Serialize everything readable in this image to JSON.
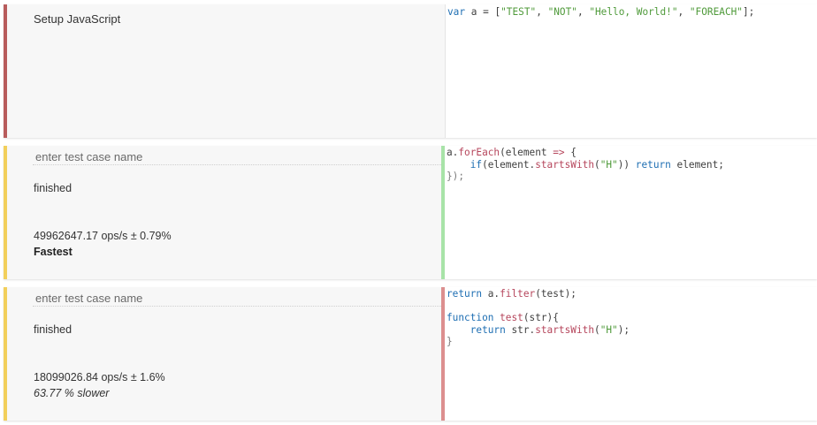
{
  "setup": {
    "title": "Setup JavaScript",
    "accent_color": "#b85c5c",
    "code": [
      [
        {
          "t": "var",
          "c": "kw"
        },
        {
          "t": " a = [",
          "c": ""
        },
        {
          "t": "\"TEST\"",
          "c": "str"
        },
        {
          "t": ", ",
          "c": ""
        },
        {
          "t": "\"NOT\"",
          "c": "str"
        },
        {
          "t": ", ",
          "c": ""
        },
        {
          "t": "\"Hello, World!\"",
          "c": "str"
        },
        {
          "t": ", ",
          "c": ""
        },
        {
          "t": "\"FOREACH\"",
          "c": "str"
        },
        {
          "t": "];",
          "c": ""
        }
      ]
    ]
  },
  "tests": [
    {
      "name_placeholder": "enter test case name",
      "name_value": "",
      "status": "finished",
      "ops": "49962647.17 ops/s ± 0.79%",
      "verdict": "Fastest",
      "verdict_type": "fast",
      "accent_color": "#f2cf5b",
      "divider_color": "#a8e3a8",
      "code": [
        [
          {
            "t": "a.",
            "c": ""
          },
          {
            "t": "forEach",
            "c": "fn"
          },
          {
            "t": "(element ",
            "c": ""
          },
          {
            "t": "=>",
            "c": "op"
          },
          {
            "t": " {",
            "c": ""
          }
        ],
        [
          {
            "t": "    ",
            "c": ""
          },
          {
            "t": "if",
            "c": "kw"
          },
          {
            "t": "(element.",
            "c": ""
          },
          {
            "t": "startsWith",
            "c": "fn"
          },
          {
            "t": "(",
            "c": ""
          },
          {
            "t": "\"H\"",
            "c": "str"
          },
          {
            "t": ")) ",
            "c": ""
          },
          {
            "t": "return",
            "c": "kw"
          },
          {
            "t": " element;",
            "c": ""
          }
        ],
        [
          {
            "t": "});",
            "c": "pun"
          }
        ]
      ]
    },
    {
      "name_placeholder": "enter test case name",
      "name_value": "",
      "status": "finished",
      "ops": "18099026.84 ops/s ± 1.6%",
      "verdict": "63.77 % slower",
      "verdict_type": "slow",
      "accent_color": "#f2cf5b",
      "divider_color": "#dc8f8f",
      "code": [
        [
          {
            "t": "return",
            "c": "kw"
          },
          {
            "t": " a.",
            "c": ""
          },
          {
            "t": "filter",
            "c": "fn"
          },
          {
            "t": "(test);",
            "c": ""
          }
        ],
        [],
        [
          {
            "t": "function",
            "c": "kw"
          },
          {
            "t": " ",
            "c": ""
          },
          {
            "t": "test",
            "c": "fn"
          },
          {
            "t": "(str){",
            "c": ""
          }
        ],
        [
          {
            "t": "    ",
            "c": ""
          },
          {
            "t": "return",
            "c": "kw"
          },
          {
            "t": " str.",
            "c": ""
          },
          {
            "t": "startsWith",
            "c": "fn"
          },
          {
            "t": "(",
            "c": ""
          },
          {
            "t": "\"H\"",
            "c": "str"
          },
          {
            "t": ");",
            "c": ""
          }
        ],
        [
          {
            "t": "}",
            "c": "pun"
          }
        ]
      ]
    }
  ]
}
